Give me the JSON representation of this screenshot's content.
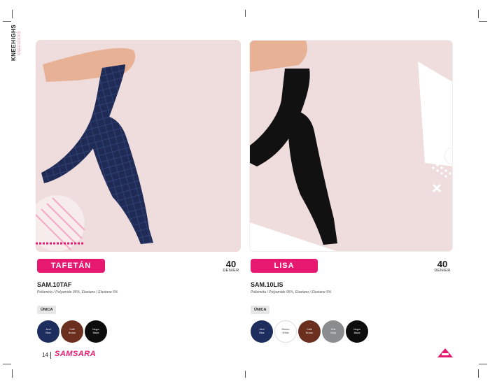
{
  "side_label": {
    "title": "KNEEHIGHS",
    "subtitle": "KNEESOCKS"
  },
  "products": [
    {
      "name": "TAFETÁN",
      "denier_value": "40",
      "denier_label": "DENIER",
      "code": "SAM.10TAF",
      "composition": "Poliamida / Polyamide 95%, Elastano / Elastane 5%",
      "size": "ÚNICA",
      "colors": [
        {
          "es": "Azul",
          "en": "Blue",
          "hex": "#1c2d5e",
          "text": "#ffffff"
        },
        {
          "es": "Café",
          "en": "Brown",
          "hex": "#6b2f20",
          "text": "#ffffff"
        },
        {
          "es": "Negro",
          "en": "Black",
          "hex": "#0d0d0d",
          "text": "#ffffff"
        }
      ]
    },
    {
      "name": "LISA",
      "denier_value": "40",
      "denier_label": "DENIER",
      "code": "SAM.10LIS",
      "composition": "Poliamida / Polyamide 95%, Elastano / Elastane 5%",
      "size": "ÚNICA",
      "colors": [
        {
          "es": "Azul",
          "en": "Blue",
          "hex": "#1c2d5e",
          "text": "#ffffff"
        },
        {
          "es": "Blanco",
          "en": "White",
          "hex": "#ffffff",
          "text": "#444444"
        },
        {
          "es": "Café",
          "en": "Brown",
          "hex": "#6b2f20",
          "text": "#ffffff"
        },
        {
          "es": "Gris",
          "en": "Grey",
          "hex": "#8a8c8e",
          "text": "#ffffff"
        },
        {
          "es": "Negro",
          "en": "Black",
          "hex": "#0d0d0d",
          "text": "#ffffff"
        }
      ]
    }
  ],
  "footer": {
    "page_number": "14",
    "brand": "SAMSARA"
  },
  "colors": {
    "accent": "#e6186f",
    "panel_bg": "#efdcdc",
    "sock_blue": "#1f2b55",
    "sock_black": "#111111",
    "skin": "#e7b196"
  }
}
